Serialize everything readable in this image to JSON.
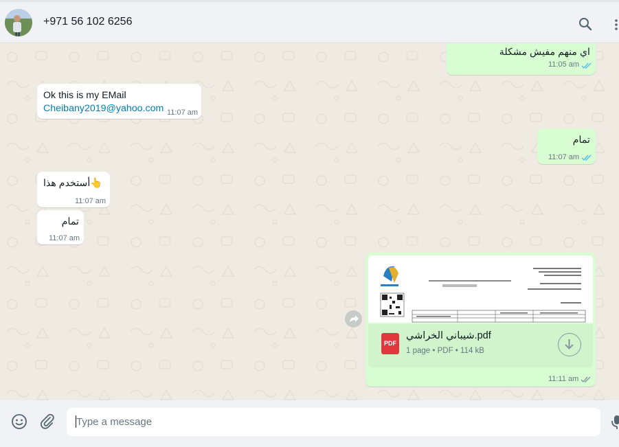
{
  "header": {
    "contact_name": "+971 56 102 6256"
  },
  "messages": [
    {
      "direction": "outgoing",
      "text": "اي منهم مفيش مشكلة",
      "time": "11:05 am",
      "status": "read"
    },
    {
      "direction": "incoming",
      "text": "Ok this is my EMail",
      "link": "Cheibany2019@yahoo.com",
      "time": "11:07 am"
    },
    {
      "direction": "outgoing",
      "text": "تمام",
      "time": "11:07 am",
      "status": "read"
    },
    {
      "direction": "incoming",
      "text": "أستخدم هذا",
      "emoji": "👆",
      "time": "11:07 am"
    },
    {
      "direction": "incoming",
      "text": "تمام",
      "time": "11:07 am"
    },
    {
      "direction": "outgoing",
      "type": "document",
      "file_name": "شيباني الخراشي.pdf",
      "file_badge": "PDF",
      "file_meta": "1 page • PDF • 114 kB",
      "time": "11:11 am",
      "status": "delivered"
    }
  ],
  "composer": {
    "placeholder": "Type a message"
  },
  "icons": {
    "search": "search-icon",
    "menu": "menu-icon",
    "emoji": "emoji-icon",
    "attach": "paperclip-icon",
    "forward": "forward-icon",
    "download": "download-icon",
    "mic": "mic-icon",
    "ticks": "double-check-icon"
  },
  "colors": {
    "incoming_bubble": "#ffffff",
    "outgoing_bubble": "#d9fdd3",
    "read_ticks": "#53bdeb",
    "delivered_ticks": "#8696a0",
    "chat_background": "#efeae2",
    "link": "#027eb5",
    "pdf_badge": "#e2373f"
  }
}
